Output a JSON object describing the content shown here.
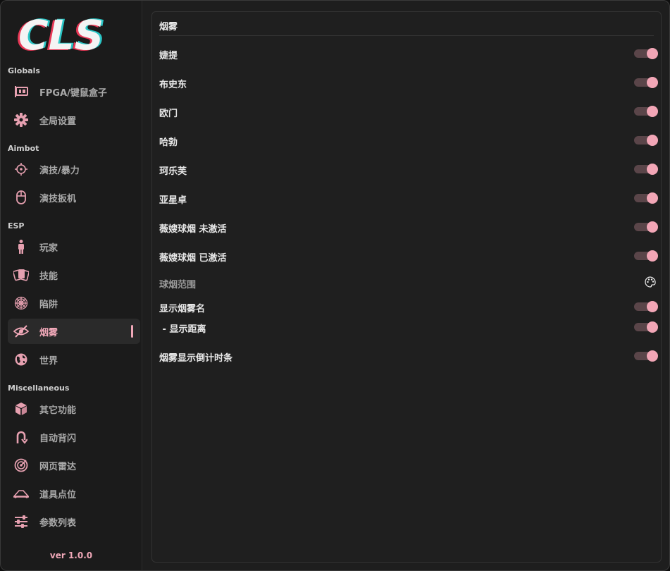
{
  "app": {
    "logo_text": "CLS",
    "version": "ver 1.0.0",
    "accent": "#f0a8b8"
  },
  "sidebar": {
    "sections": {
      "globals": "Globals",
      "aimbot": "Aimbot",
      "esp": "ESP",
      "misc": "Miscellaneous"
    },
    "items": [
      {
        "label": "FPGA/键鼠盒子",
        "icon": "pci-card-icon"
      },
      {
        "label": "全局设置",
        "icon": "gear-icon"
      },
      {
        "label": "演技/暴力",
        "icon": "crosshair-icon"
      },
      {
        "label": "演技扳机",
        "icon": "mouse-icon"
      },
      {
        "label": "玩家",
        "icon": "person-icon"
      },
      {
        "label": "技能",
        "icon": "cards-icon"
      },
      {
        "label": "陷阱",
        "icon": "spiderweb-icon"
      },
      {
        "label": "烟雾",
        "icon": "eye-slash-icon",
        "active": true
      },
      {
        "label": "世界",
        "icon": "globe-icon"
      },
      {
        "label": "其它功能",
        "icon": "cube-icon"
      },
      {
        "label": "自动背闪",
        "icon": "u-turn-icon"
      },
      {
        "label": "网页雷达",
        "icon": "radar-icon"
      },
      {
        "label": "道具点位",
        "icon": "map-location-icon"
      },
      {
        "label": "参数列表",
        "icon": "sliders-icon"
      }
    ]
  },
  "panel": {
    "title": "烟雾",
    "rows": [
      {
        "label": "婕提",
        "type": "toggle",
        "on": true
      },
      {
        "label": "布史东",
        "type": "toggle",
        "on": true
      },
      {
        "label": "欧门",
        "type": "toggle",
        "on": true
      },
      {
        "label": "哈勃",
        "type": "toggle",
        "on": true
      },
      {
        "label": "珂乐芙",
        "type": "toggle",
        "on": true
      },
      {
        "label": "亚星卓",
        "type": "toggle",
        "on": true
      },
      {
        "label": "薇嫂球烟 未激活",
        "type": "toggle",
        "on": true
      },
      {
        "label": "薇嫂球烟 已激活",
        "type": "toggle",
        "on": true
      },
      {
        "label": "球烟范围",
        "type": "color",
        "icon": "palette-icon"
      },
      {
        "label": "显示烟雾名",
        "type": "toggle",
        "on": true
      },
      {
        "label": " - 显示距离",
        "type": "toggle",
        "on": true
      },
      {
        "label": "烟雾显示倒计时条",
        "type": "toggle",
        "on": true
      }
    ]
  }
}
